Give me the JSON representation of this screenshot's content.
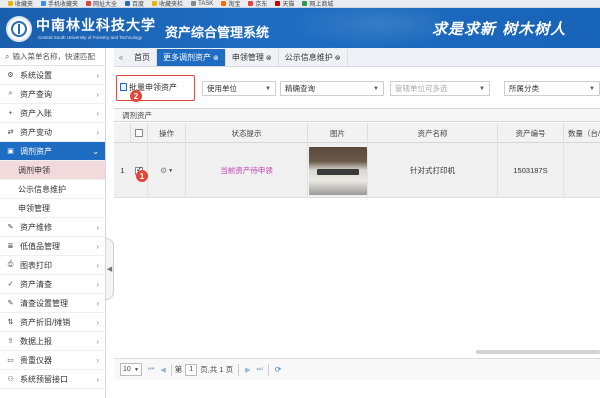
{
  "bookmarks": [
    {
      "label": "收藏夹",
      "color": "#f0b400"
    },
    {
      "label": "手机收藏夹",
      "color": "#3c8df0"
    },
    {
      "label": "网址大全",
      "color": "#e2463b"
    },
    {
      "label": "百度",
      "color": "#2a6bb8"
    },
    {
      "label": "收藏夹栏",
      "color": "#f0b400"
    },
    {
      "label": "TASK",
      "color": "#888888"
    },
    {
      "label": "淘宝",
      "color": "#ff6a00"
    },
    {
      "label": "京东",
      "color": "#e2463b"
    },
    {
      "label": "天猫",
      "color": "#c80000"
    },
    {
      "label": "网上商城",
      "color": "#2a9d4f"
    }
  ],
  "header": {
    "school_name": "中南林业科技大学",
    "school_name_en": "Central South University of Forestry and Technology",
    "system_title": "资产综合管理系统",
    "motto": "求是求新 树木树人"
  },
  "sidebar": {
    "search_text": "输入菜单名称，快速匹配",
    "items": [
      {
        "label": "系统设置",
        "icon": "gear-icon",
        "glyph": "⚙",
        "active": false
      },
      {
        "label": "资产查询",
        "icon": "search-icon",
        "glyph": "⌕",
        "active": false
      },
      {
        "label": "资产入账",
        "icon": "plus-icon",
        "glyph": "+",
        "active": false
      },
      {
        "label": "资产变动",
        "icon": "shuffle-icon",
        "glyph": "⇄",
        "active": false
      },
      {
        "label": "调剂资产",
        "icon": "box-icon",
        "glyph": "▣",
        "active": true
      }
    ],
    "sub_items": [
      {
        "label": "调剂申领",
        "current": true
      },
      {
        "label": "公示信息维护",
        "current": false
      },
      {
        "label": "申领管理",
        "current": false
      }
    ],
    "items_after": [
      {
        "label": "资产维修",
        "icon": "wrench-icon",
        "glyph": "✎"
      },
      {
        "label": "低值品管理",
        "icon": "list-icon",
        "glyph": "≣"
      },
      {
        "label": "图表打印",
        "icon": "print-icon",
        "glyph": "⎙"
      },
      {
        "label": "资产清查",
        "icon": "check-icon",
        "glyph": "✓"
      },
      {
        "label": "清查设置管理",
        "icon": "edit-icon",
        "glyph": "✎"
      },
      {
        "label": "资产折旧/摊销",
        "icon": "sort-icon",
        "glyph": "⇅"
      },
      {
        "label": "数据上报",
        "icon": "upload-icon",
        "glyph": "⇪"
      },
      {
        "label": "贵重仪器",
        "icon": "truck-icon",
        "glyph": "▭"
      },
      {
        "label": "系统预留接口",
        "icon": "link-icon",
        "glyph": "⚇"
      }
    ]
  },
  "tabs": {
    "home": "首页",
    "items": [
      {
        "label": "更多调剂资产",
        "active": true
      },
      {
        "label": "申领管理",
        "active": false
      },
      {
        "label": "公示信息维护",
        "active": false
      }
    ]
  },
  "toolbar": {
    "apply_label": "批量申领资产",
    "unit_select": "使用单位",
    "query_select": "精确查询",
    "dept_placeholder": "管辖单位可多选",
    "category_select": "所属分类"
  },
  "markers": {
    "one": "1",
    "two": "2"
  },
  "grid": {
    "title": "调剂资产",
    "columns": [
      "",
      "操作",
      "状态提示",
      "图片",
      "资产名称",
      "资产编号",
      "数量（台/"
    ],
    "rows": [
      {
        "index": "1",
        "status": "当前资产待申领",
        "name": "针对式打印机",
        "code": "1503187S",
        "checked": true
      }
    ]
  },
  "pager": {
    "page_size": "10",
    "page_label_before": "第",
    "page_value": "1",
    "page_label_after": "页,共 1 页"
  }
}
